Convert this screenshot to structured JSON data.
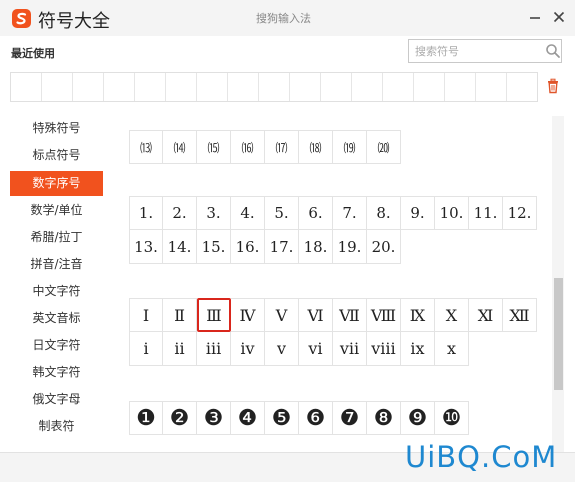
{
  "window": {
    "app_title": "符号大全",
    "title": "搜狗输入法",
    "minimize_icon": "minimize-icon",
    "close_icon": "close-icon",
    "brand_color": "#f1521e"
  },
  "recent": {
    "label": "最近使用",
    "slots": 17,
    "trash_icon": "trash-icon"
  },
  "search": {
    "placeholder": "搜索符号",
    "value": "",
    "icon": "search-icon"
  },
  "sidebar": {
    "active_index": 2,
    "items": [
      {
        "label": "特殊符号"
      },
      {
        "label": "标点符号"
      },
      {
        "label": "数字序号"
      },
      {
        "label": "数学/单位"
      },
      {
        "label": "希腊/拉丁"
      },
      {
        "label": "拼音/注音"
      },
      {
        "label": "中文字符"
      },
      {
        "label": "英文音标"
      },
      {
        "label": "日文字符"
      },
      {
        "label": "韩文字符"
      },
      {
        "label": "俄文字母"
      },
      {
        "label": "制表符"
      }
    ]
  },
  "groups": [
    {
      "name": "parenthesized-numbers",
      "style": "paren",
      "rows": [
        [
          "⒀",
          "⒁",
          "⒂",
          "⒃",
          "⒄",
          "⒅",
          "⒆",
          "⒇"
        ]
      ]
    },
    {
      "name": "dotted-numbers",
      "style": "dot",
      "rows": [
        [
          "1.",
          "2.",
          "3.",
          "4.",
          "5.",
          "6.",
          "7.",
          "8.",
          "9.",
          "10.",
          "11.",
          "12."
        ],
        [
          "13.",
          "14.",
          "15.",
          "16.",
          "17.",
          "18.",
          "19.",
          "20."
        ]
      ]
    },
    {
      "name": "roman-numerals",
      "style": "roman",
      "rows": [
        [
          "Ⅰ",
          "Ⅱ",
          "Ⅲ",
          "Ⅳ",
          "Ⅴ",
          "Ⅵ",
          "Ⅶ",
          "Ⅷ",
          "Ⅸ",
          "Ⅹ",
          "Ⅺ",
          "Ⅻ"
        ],
        [
          "ⅰ",
          "ⅱ",
          "ⅲ",
          "ⅳ",
          "ⅴ",
          "ⅵ",
          "ⅶ",
          "ⅷ",
          "ⅸ",
          "ⅹ"
        ]
      ]
    },
    {
      "name": "circled-numbers",
      "style": "circ",
      "rows": [
        [
          "❶",
          "❷",
          "❸",
          "❹",
          "❺",
          "❻",
          "❼",
          "❽",
          "❾",
          "❿"
        ]
      ]
    }
  ],
  "selected_symbol": "Ⅲ",
  "watermark": "UiBQ.CoM"
}
